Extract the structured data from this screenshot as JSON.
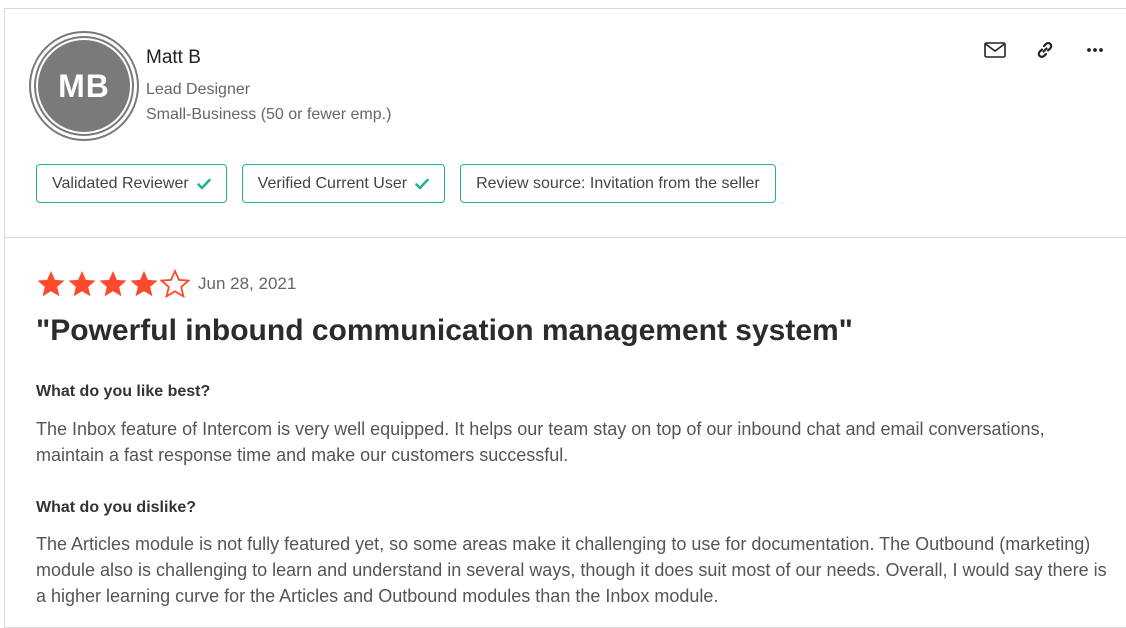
{
  "reviewer": {
    "initials": "MB",
    "name": "Matt B",
    "title": "Lead Designer",
    "company_size": "Small-Business (50 or fewer emp.)"
  },
  "actions": {
    "email_icon": "mail-icon",
    "link_icon": "link-icon",
    "more_icon": "more-horizontal-icon"
  },
  "badges": [
    {
      "label": "Validated Reviewer",
      "check": true
    },
    {
      "label": "Verified Current User",
      "check": true
    },
    {
      "label": "Review source: Invitation from the seller",
      "check": false
    }
  ],
  "review": {
    "rating": 4,
    "rating_max": 5,
    "date": "Jun 28, 2021",
    "title": "\"Powerful inbound communication management system\"",
    "questions": [
      {
        "question": "What do you like best?",
        "answer": "The Inbox feature of Intercom is very well equipped. It helps our team stay on top of our inbound chat and email conversations, maintain a fast response time and make our customers successful."
      },
      {
        "question": "What do you dislike?",
        "answer": "The Articles module is not fully featured yet, so some areas make it challenging to use for documentation. The Outbound (marketing) module also is challenging to learn and understand in several ways, though it does suit most of our needs. Overall, I would say there is a higher learning curve for the Articles and Outbound modules than the Inbox module."
      }
    ]
  },
  "colors": {
    "star": "#ff492c",
    "badge_border": "#27b38d",
    "check": "#27b38d",
    "avatar_bg": "#7a7a7a"
  }
}
